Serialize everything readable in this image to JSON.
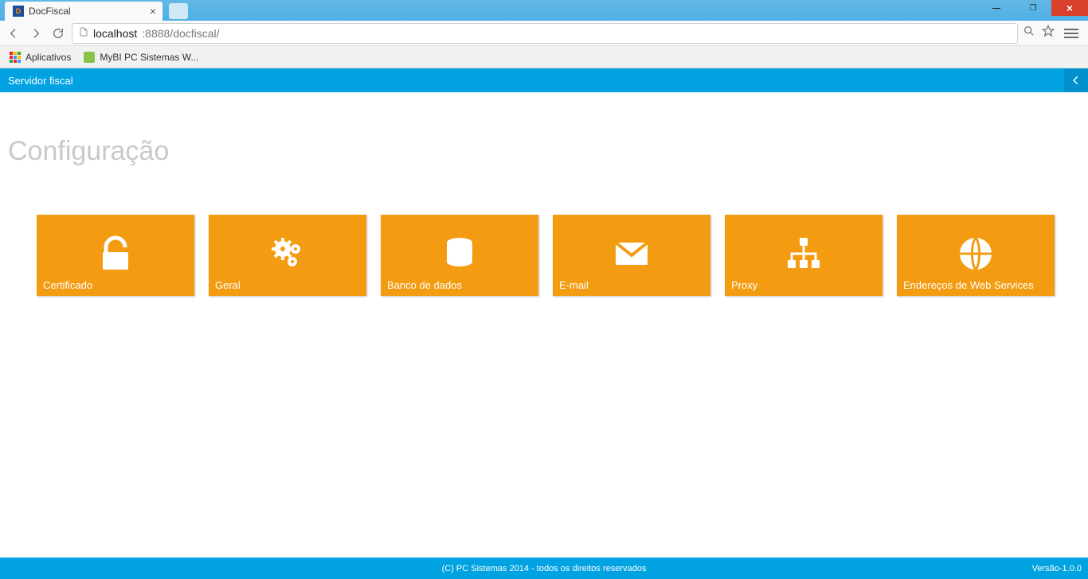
{
  "browser": {
    "tab_title": "DocFiscal",
    "url_host": "localhost",
    "url_port_path": ":8888/docfiscal/",
    "bookmarks_apps": "Aplicativos",
    "bookmark_1": "MyBI PC Sistemas W..."
  },
  "app": {
    "header_title": "Servidor fiscal",
    "page_title": "Configuração",
    "footer_copyright": "(C) PC Sistemas 2014 - todos os direitos reservados",
    "footer_version": "Versão-1.0.0"
  },
  "tiles": [
    {
      "label": "Certificado",
      "icon": "unlock-icon"
    },
    {
      "label": "Geral",
      "icon": "gears-icon"
    },
    {
      "label": "Banco de dados",
      "icon": "database-icon"
    },
    {
      "label": "E-mail",
      "icon": "envelope-icon"
    },
    {
      "label": "Proxy",
      "icon": "sitemap-icon"
    },
    {
      "label": "Endereços de Web Services",
      "icon": "globe-icon"
    }
  ],
  "colors": {
    "tile": "#f39c12",
    "header": "#00a2e1"
  }
}
